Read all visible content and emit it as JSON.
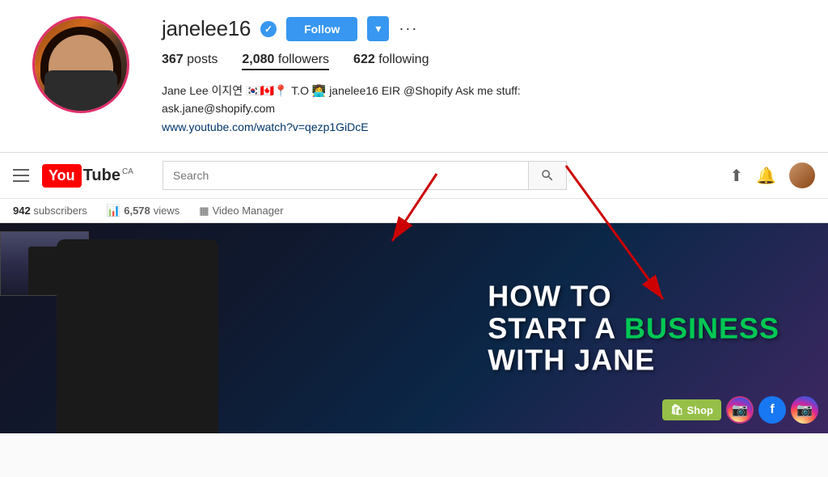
{
  "instagram": {
    "username": "janelee16",
    "verified": true,
    "follow_label": "Follow",
    "dropdown_label": "▾",
    "more_label": "···",
    "posts_count": "367",
    "posts_label": "posts",
    "followers_count": "2,080",
    "followers_label": "followers",
    "following_count": "622",
    "following_label": "following",
    "bio_text": "Jane Lee 이지연 🇰🇷🇨🇦📍 T.O 👩‍💻 janelee16 EIR @Shopify Ask me stuff:",
    "bio_email": "ask.jane@shopify.com",
    "bio_link": "www.youtube.com/watch?v=qezp1GiDcE"
  },
  "youtube": {
    "logo_text": "You",
    "logo_tube": "Tube",
    "logo_region": "CA",
    "search_placeholder": "Search",
    "search_label": "Search",
    "subscribers_count": "942",
    "subscribers_label": "subscribers",
    "views_count": "6,578",
    "views_label": "views",
    "video_manager_label": "Video Manager",
    "channel_banner": {
      "line1": "HOW TO",
      "line2_white": "START A",
      "line2_green": "BUSINESS",
      "line3": "WITH JANE"
    }
  },
  "social_bar": {
    "shop_label": "Shop",
    "instagram_label": "IG",
    "facebook_label": "f",
    "instagram2_label": "IG"
  }
}
